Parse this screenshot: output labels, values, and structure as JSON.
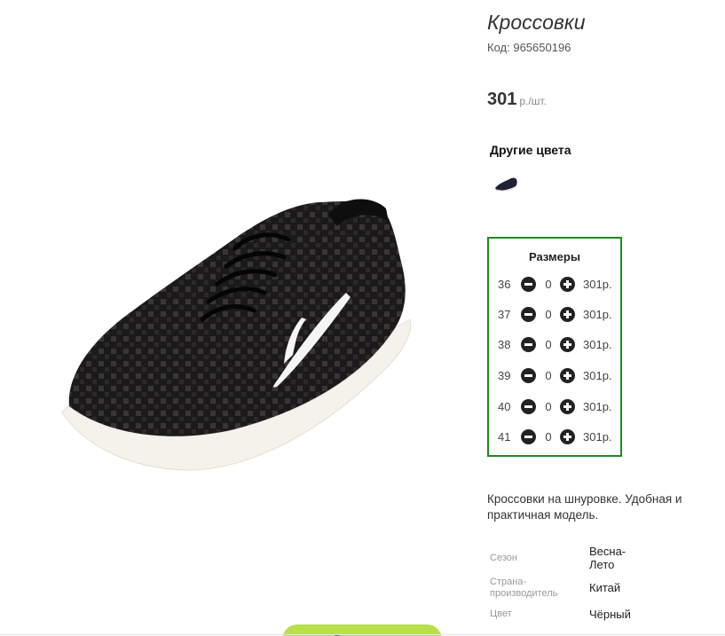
{
  "product": {
    "title": "Кроссовки",
    "code_label": "Код:",
    "code": "965650196",
    "price_value": "301",
    "price_unit": "р./шт.",
    "cart_button_label": "В корзину"
  },
  "other_colors": {
    "title": "Другие цвета",
    "thumbnails": [
      "shoe-thumbnail-black"
    ]
  },
  "sizes": {
    "title": "Размеры",
    "rows": [
      {
        "size": "36",
        "qty": "0",
        "price": "301р."
      },
      {
        "size": "37",
        "qty": "0",
        "price": "301р."
      },
      {
        "size": "38",
        "qty": "0",
        "price": "301р."
      },
      {
        "size": "39",
        "qty": "0",
        "price": "301р."
      },
      {
        "size": "40",
        "qty": "0",
        "price": "301р."
      },
      {
        "size": "41",
        "qty": "0",
        "price": "301р."
      }
    ]
  },
  "description": "Кроссовки на шнуровке. Удобная и практичная модель.",
  "specs": [
    {
      "label": "Сезон",
      "value": "Весна-Лето"
    },
    {
      "label": "Страна-производитель",
      "value": "Китай"
    },
    {
      "label": "Цвет",
      "value": "Чёрный"
    }
  ],
  "colors": {
    "sizes_border": "#1f8a1f",
    "cart_button": "#b8e04a",
    "shoe_body": "#1a1a1a",
    "shoe_sole": "#f4f2ea"
  },
  "icons": {
    "minus": "minus-circle-icon",
    "plus": "plus-circle-icon"
  }
}
